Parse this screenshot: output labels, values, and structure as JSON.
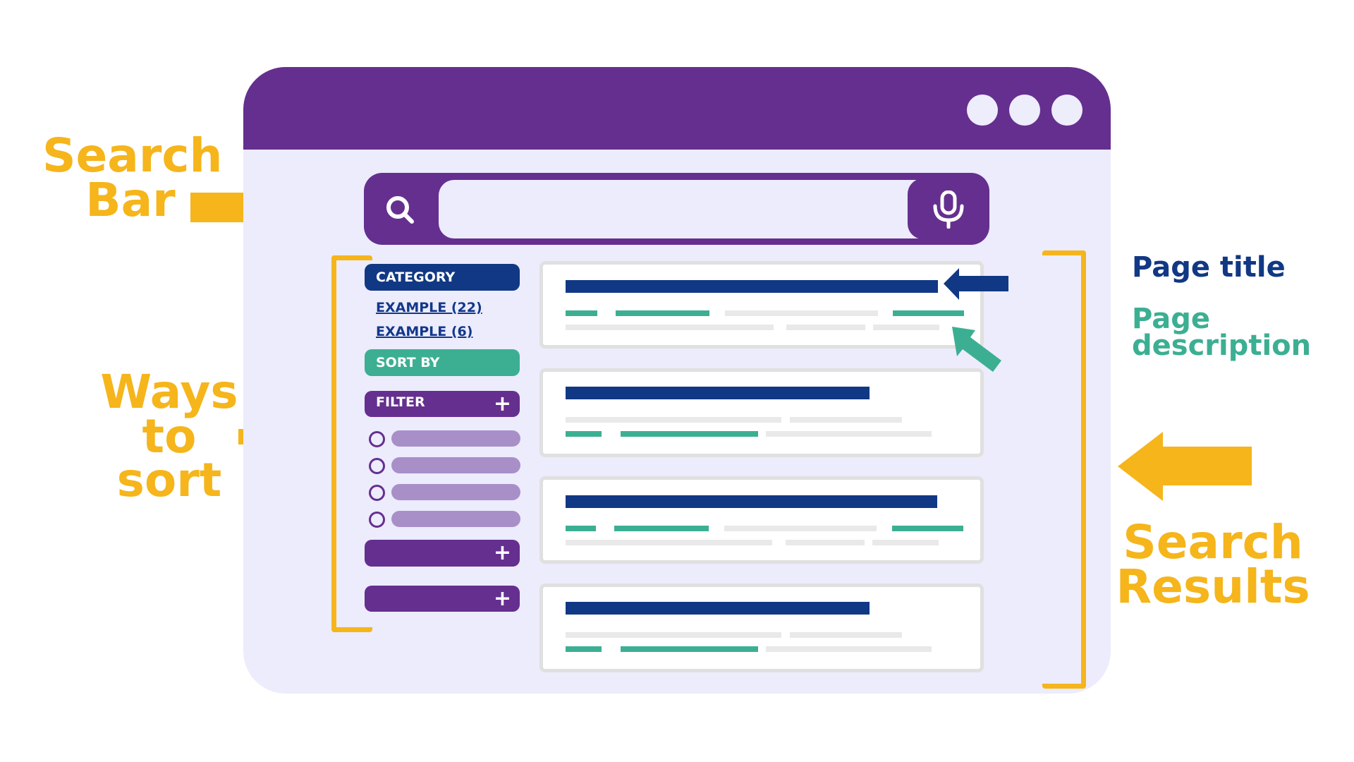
{
  "annotations": {
    "search_bar": [
      "Search",
      "Bar"
    ],
    "ways_to_sort": [
      "Ways",
      "to",
      "sort"
    ],
    "search_results": [
      "Search",
      "Results"
    ],
    "page_title": "Page title",
    "page_description": [
      "Page",
      "description"
    ]
  },
  "browser": {
    "window_controls": [
      "dot",
      "dot",
      "dot"
    ],
    "search": {
      "value": "",
      "placeholder": "",
      "search_icon": "search-icon",
      "mic_icon": "microphone-icon"
    }
  },
  "sidebar": {
    "category_label": "CATEGORY",
    "category_links": [
      "EXAMPLE (22)",
      "EXAMPLE (6)"
    ],
    "sort_by_label": "SORT BY",
    "filter_label": "FILTER",
    "filter_options_count": 4,
    "expand_symbol": "+"
  },
  "results": {
    "count": 4
  },
  "colors": {
    "purple": "#652f8f",
    "navy": "#113884",
    "teal": "#3caf93",
    "yellow": "#f5b51b",
    "lavender": "#ececfc",
    "light_purple": "#a98fc8"
  }
}
